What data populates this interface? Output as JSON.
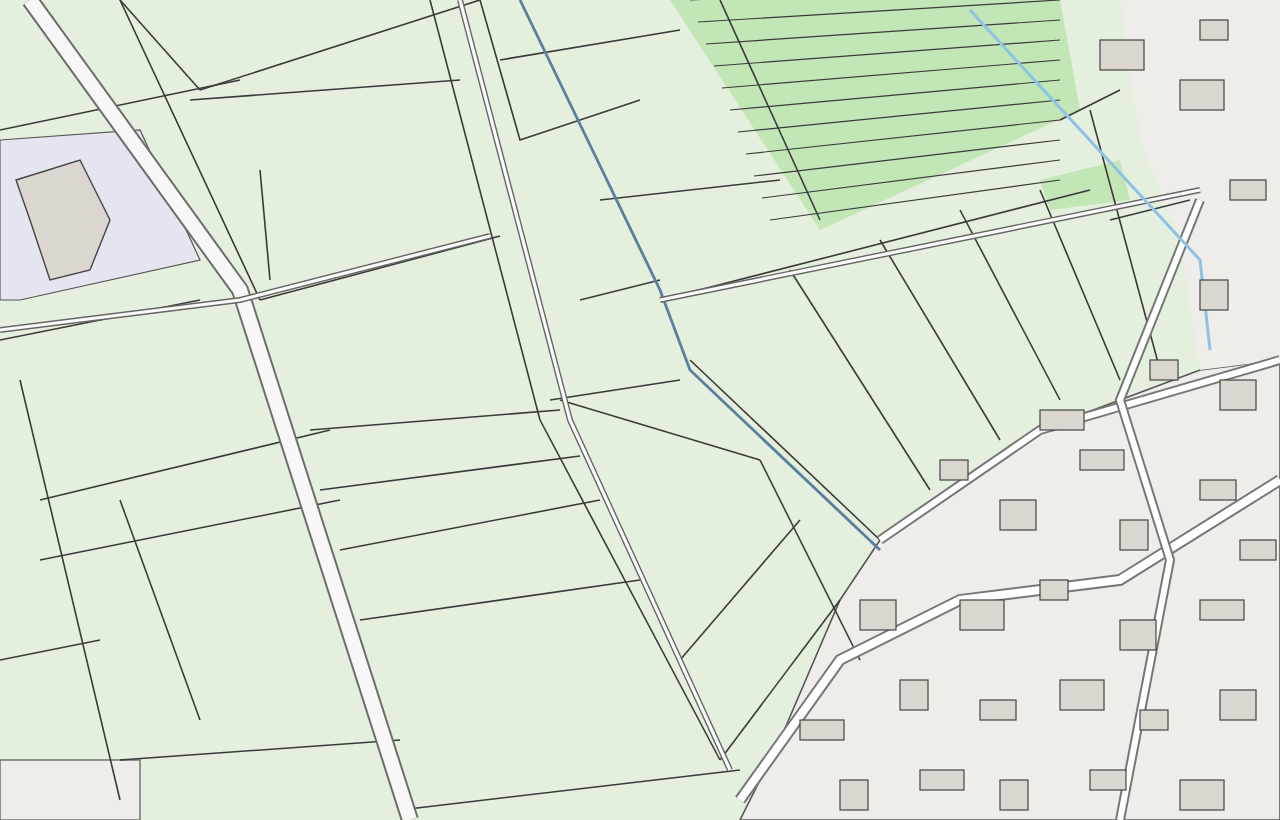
{
  "map": {
    "kind": "cadastral"
  }
}
